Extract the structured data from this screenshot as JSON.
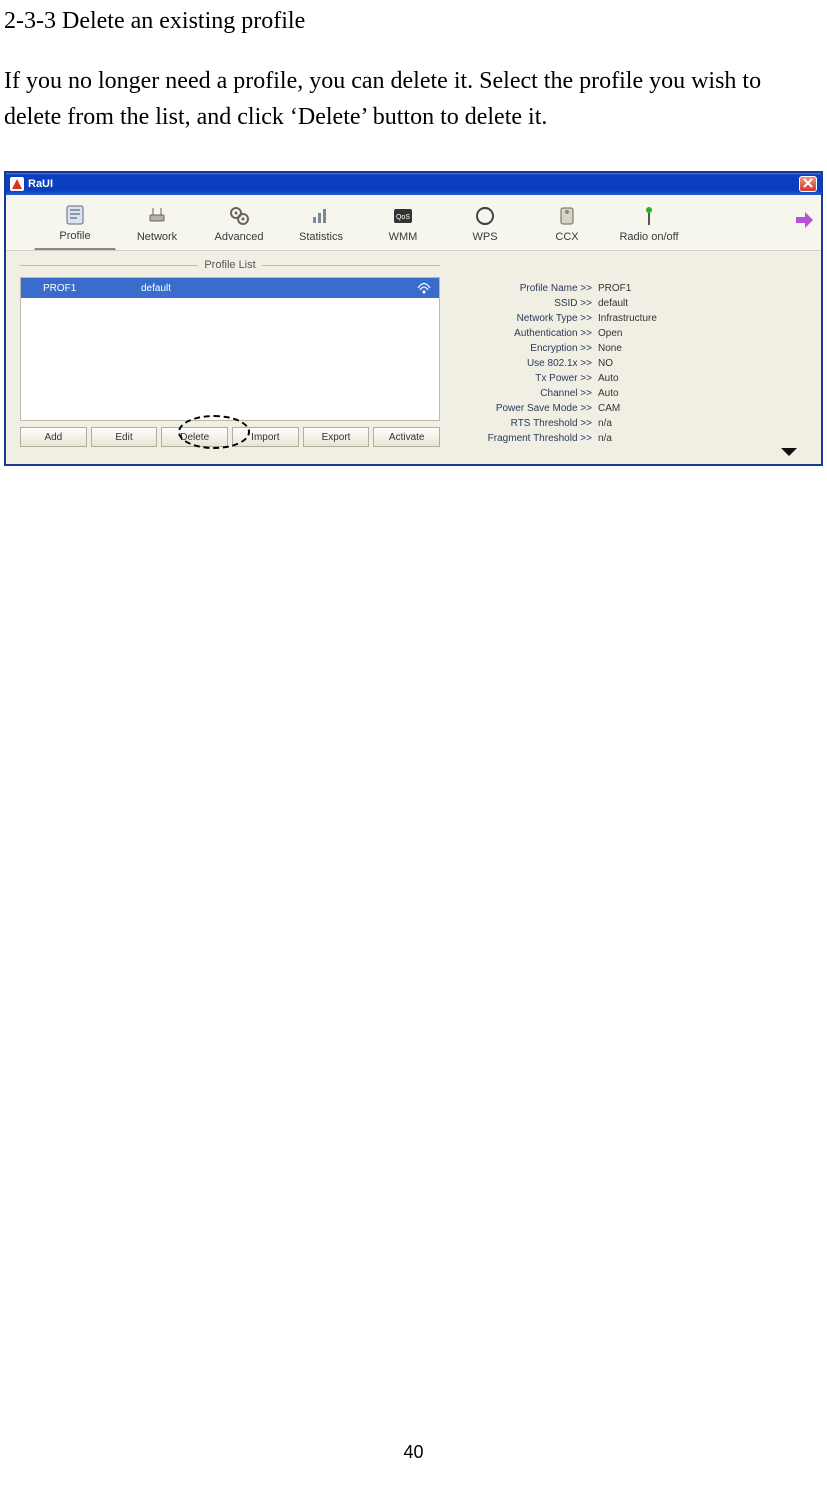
{
  "page": {
    "heading": "2-3-3 Delete an existing profile",
    "body": "If you no longer need a profile, you can delete it. Select the profile you wish to delete from the list, and click ‘Delete’ button to delete it.",
    "number": "40"
  },
  "window": {
    "title": "RaUI"
  },
  "toolbar": {
    "items": [
      {
        "label": "Profile",
        "icon": "profile-icon"
      },
      {
        "label": "Network",
        "icon": "network-icon"
      },
      {
        "label": "Advanced",
        "icon": "advanced-icon"
      },
      {
        "label": "Statistics",
        "icon": "statistics-icon"
      },
      {
        "label": "WMM",
        "icon": "wmm-icon"
      },
      {
        "label": "WPS",
        "icon": "wps-icon"
      },
      {
        "label": "CCX",
        "icon": "ccx-icon"
      },
      {
        "label": "Radio on/off",
        "icon": "radio-icon"
      }
    ]
  },
  "profileList": {
    "title": "Profile List",
    "rows": [
      {
        "name": "PROF1",
        "ssid": "default"
      }
    ],
    "buttons": {
      "add": "Add",
      "edit": "Edit",
      "delete": "Delete",
      "import": "Import",
      "export": "Export",
      "activate": "Activate"
    }
  },
  "details": {
    "rows": [
      {
        "label": "Profile Name >>",
        "value": "PROF1"
      },
      {
        "label": "SSID >>",
        "value": "default"
      },
      {
        "label": "Network Type >>",
        "value": "Infrastructure"
      },
      {
        "label": "Authentication >>",
        "value": "Open"
      },
      {
        "label": "Encryption >>",
        "value": "None"
      },
      {
        "label": "Use 802.1x >>",
        "value": "NO"
      },
      {
        "label": "Tx Power >>",
        "value": "Auto"
      },
      {
        "label": "Channel >>",
        "value": "Auto"
      },
      {
        "label": "Power Save Mode >>",
        "value": "CAM"
      },
      {
        "label": "RTS Threshold >>",
        "value": "n/a"
      },
      {
        "label": "Fragment Threshold >>",
        "value": "n/a"
      }
    ]
  }
}
